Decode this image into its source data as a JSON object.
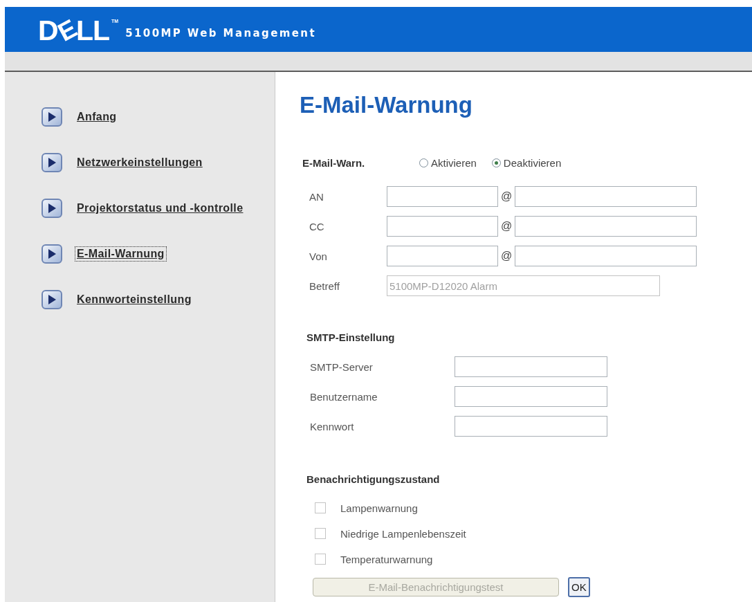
{
  "header": {
    "logo": "DELL",
    "trademark": "TM",
    "title": "5100MP Web Management"
  },
  "sidebar": {
    "items": [
      {
        "label": "Anfang",
        "selected": false
      },
      {
        "label": "Netzwerkeinstellungen",
        "selected": false
      },
      {
        "label": "Projektorstatus und -kontrolle",
        "selected": false
      },
      {
        "label": "E-Mail-Warnung",
        "selected": true
      },
      {
        "label": "Kennworteinstellung",
        "selected": false
      }
    ]
  },
  "page_title": "E-Mail-Warnung",
  "alert": {
    "label": "E-Mail-Warn.",
    "options": [
      {
        "label": "Aktivieren",
        "selected": false
      },
      {
        "label": "Deaktivieren",
        "selected": true
      }
    ]
  },
  "addresses": [
    {
      "label": "AN",
      "separator": "@"
    },
    {
      "label": "CC",
      "separator": "@"
    },
    {
      "label": "Von",
      "separator": "@"
    }
  ],
  "subject": {
    "label": "Betreff",
    "value": "5100MP-D12020 Alarm",
    "disabled": true
  },
  "smtp": {
    "heading": "SMTP-Einstellung",
    "fields": [
      {
        "label": "SMTP-Server"
      },
      {
        "label": "Benutzername"
      },
      {
        "label": "Kennwort"
      }
    ]
  },
  "notifications": {
    "heading": "Benachrichtigungszustand",
    "items": [
      {
        "label": "Lampenwarnung",
        "checked": false
      },
      {
        "label": "Niedrige Lampenlebenszeit",
        "checked": false
      },
      {
        "label": "Temperaturwarnung",
        "checked": false
      }
    ]
  },
  "buttons": [
    {
      "label": "E-Mail-Benachrichtigungstest",
      "disabled": true
    },
    {
      "label": "OK",
      "disabled": false
    }
  ]
}
